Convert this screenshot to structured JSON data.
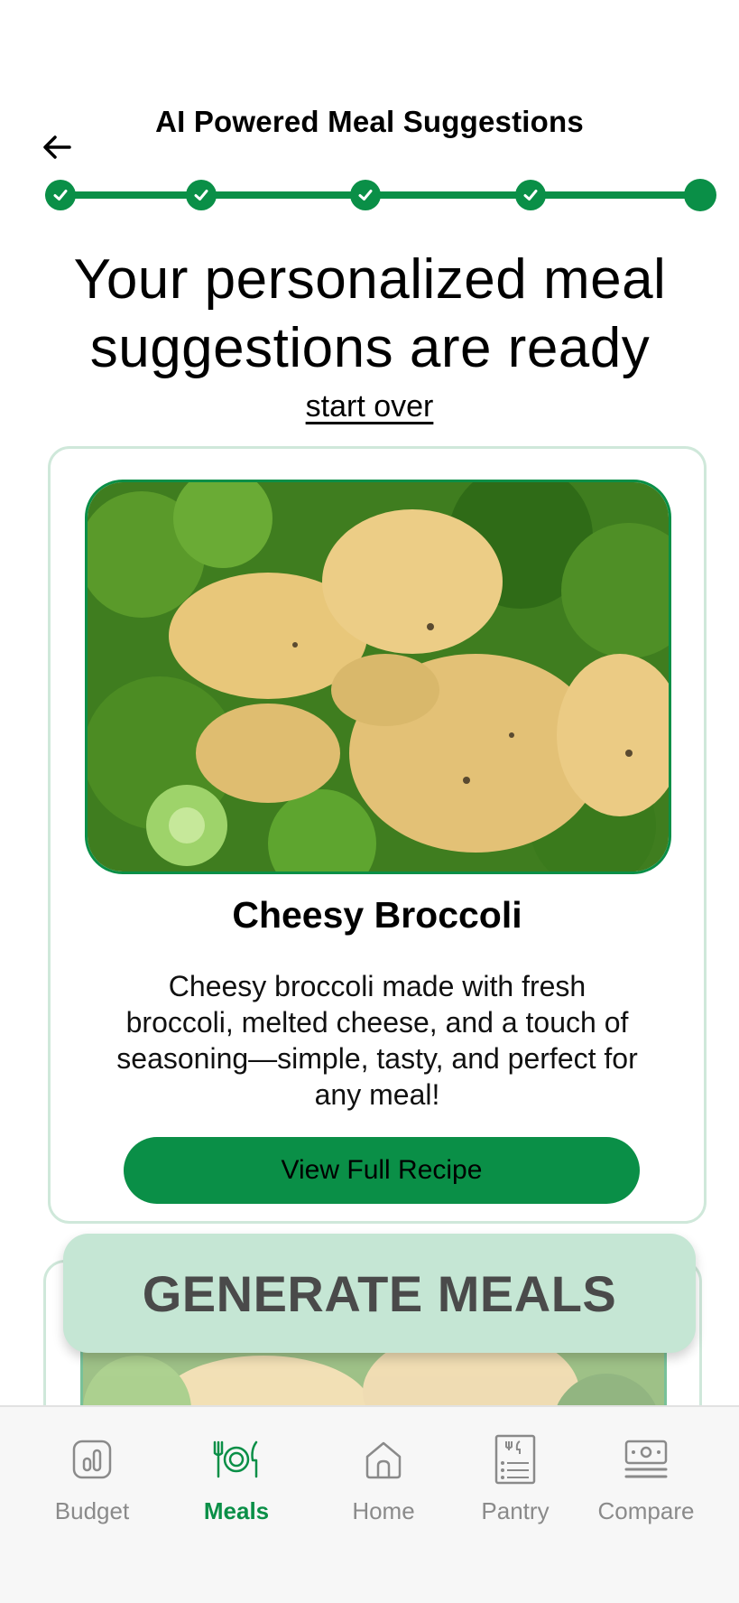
{
  "header": {
    "title": "AI Powered Meal Suggestions"
  },
  "progress": {
    "completed_steps": 4,
    "total_steps": 5,
    "accent_color": "#0a8f47"
  },
  "headline": {
    "line1": "Your personalized meal",
    "line2": "suggestions are ready"
  },
  "start_over_label": "start over",
  "meal_card": {
    "title": "Cheesy Broccoli",
    "description": "Cheesy broccoli made with fresh broccoli, melted cheese, and a touch of seasoning—simple, tasty, and perfect for any meal!",
    "button_label": "View Full Recipe"
  },
  "generate_label": "GENERATE MEALS",
  "tabs": [
    {
      "label": "Budget",
      "icon": "budget-chart-icon",
      "active": false
    },
    {
      "label": "Meals",
      "icon": "plate-cutlery-icon",
      "active": true
    },
    {
      "label": "Home",
      "icon": "home-icon",
      "active": false
    },
    {
      "label": "Pantry",
      "icon": "pantry-list-icon",
      "active": false
    },
    {
      "label": "Compare",
      "icon": "compare-money-icon",
      "active": false
    }
  ],
  "colors": {
    "brand_green": "#0a8f47",
    "generate_bg": "#c5e6d4",
    "card_border": "#cfe8da",
    "tab_inactive": "#8a8a8a"
  }
}
